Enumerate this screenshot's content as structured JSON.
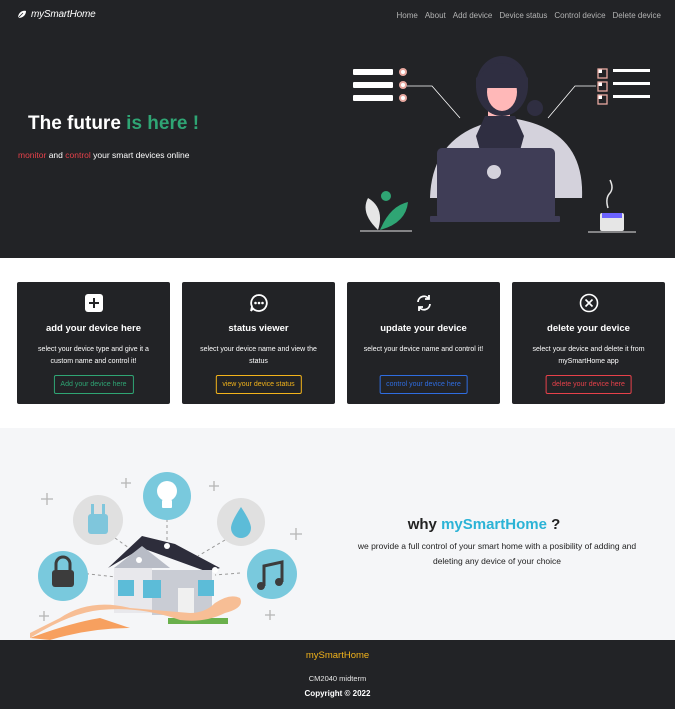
{
  "nav": {
    "brand": "mySmartHome",
    "links": [
      "Home",
      "About",
      "Add device",
      "Device status",
      "Control device",
      "Delete device"
    ]
  },
  "hero": {
    "title_main": "The future ",
    "title_accent": "is here !",
    "sub_monitor": "monitor",
    "sub_and": " and ",
    "sub_control": "control",
    "sub_rest": " your smart devices online"
  },
  "cards": [
    {
      "icon": "plus-square-icon",
      "title": "add your device here",
      "text": "select your device type and give it a custom name and control it!",
      "button": "Add your device here",
      "color": "#2fa574"
    },
    {
      "icon": "chat-dots-icon",
      "title": "status viewer",
      "text": "select your device name and view the status",
      "button": "view your device status",
      "color": "#f2b31b"
    },
    {
      "icon": "refresh-icon",
      "title": "update your device",
      "text": "select your device name and control it!",
      "button": "control your device here",
      "color": "#2f6de0"
    },
    {
      "icon": "close-circle-icon",
      "title": "delete your device",
      "text": "select your device and delete it from mySmartHome app",
      "button": "delete your device here",
      "color": "#e6414a"
    }
  ],
  "why": {
    "title_prefix": "why ",
    "title_brand": "mySmartHome",
    "title_suffix": " ?",
    "text": "we provide a full control of your smart home with a posibility of adding and deleting any device of your choice"
  },
  "footer": {
    "brand": "mySmartHome",
    "course": "CM2040 midterm",
    "copyright": "Copyright © 2022"
  },
  "colors": {
    "dark": "#222326",
    "green": "#2fa574",
    "red": "#e6414a",
    "blue": "#2bb3d6",
    "yellow": "#f2b31b"
  }
}
